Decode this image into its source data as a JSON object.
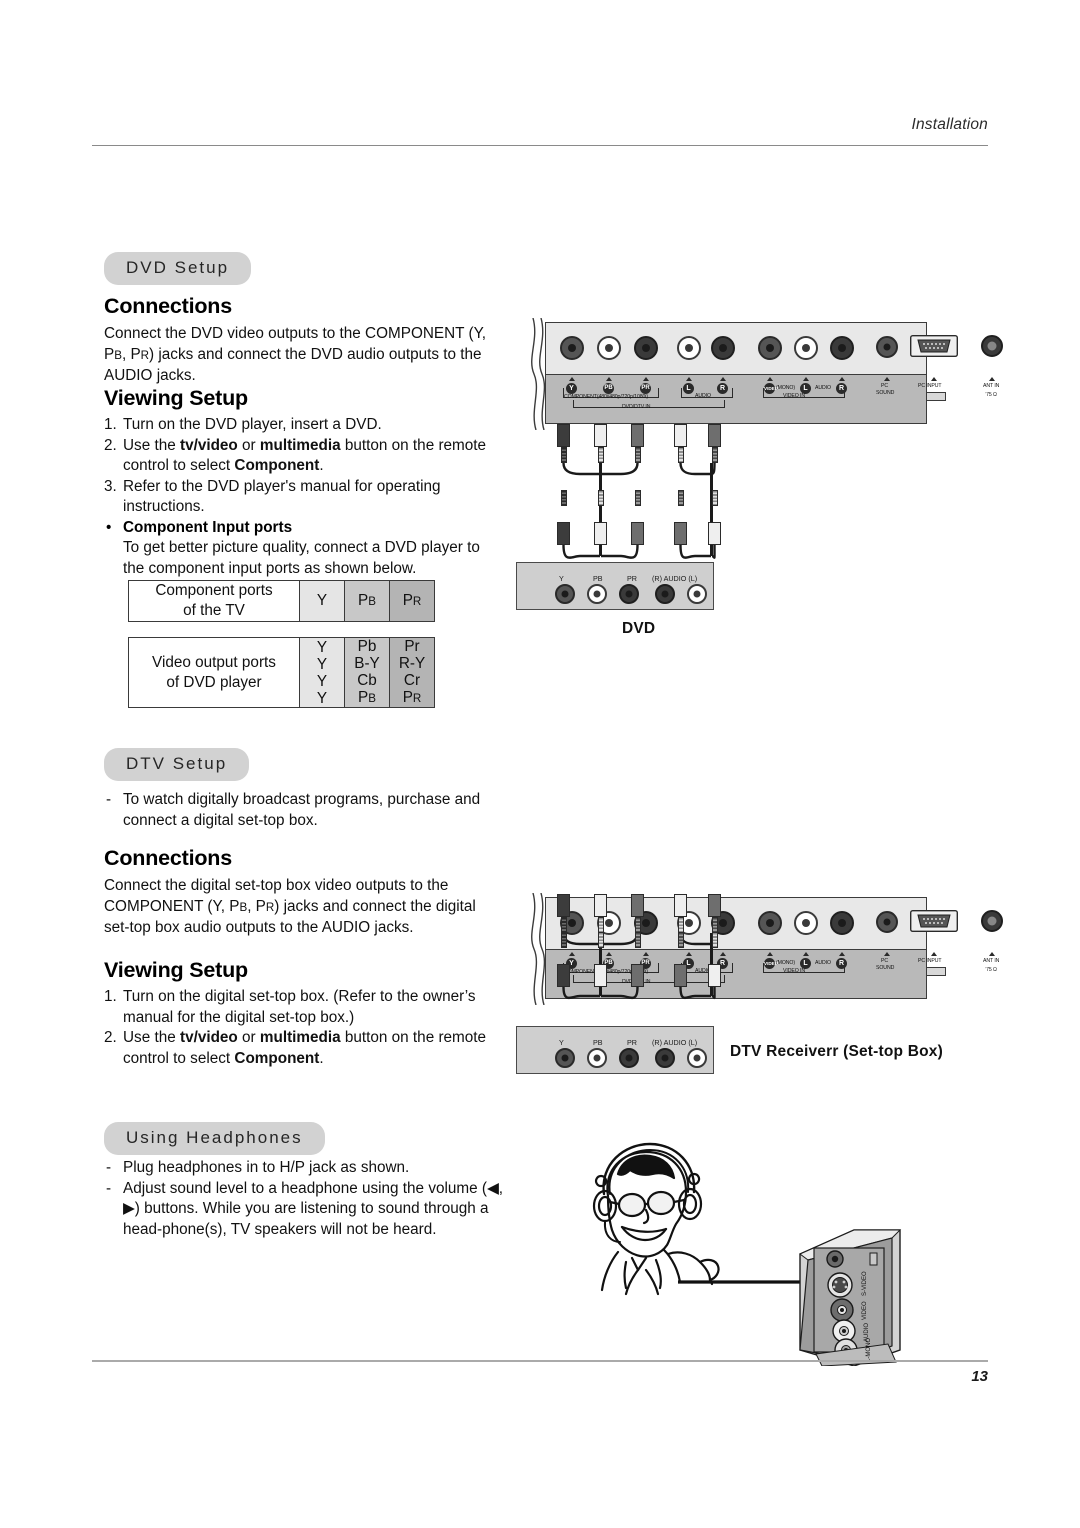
{
  "header": {
    "title": "Installation"
  },
  "footer": {
    "page_number": "13"
  },
  "sections": {
    "dvd": {
      "pill_label": "DVD Setup",
      "connections_heading": "Connections",
      "connections_body_line1": "Connect the DVD video outputs to the COMPONENT",
      "connections_body_line2_pre": "(Y, P",
      "connections_body_line2_sub1": "B",
      "connections_body_line2_mid": ", P",
      "connections_body_line2_sub2": "R",
      "connections_body_line2_post": ") jacks and connect the DVD audio outputs",
      "connections_body_line3": "to the AUDIO jacks.",
      "viewing_heading": "Viewing Setup",
      "steps": [
        {
          "num": "1.",
          "text": "Turn on the DVD player, insert a DVD."
        },
        {
          "num": "2.",
          "text_a": "Use the ",
          "bold_a": "tv/video",
          "text_b": " or ",
          "bold_b": "multimedia",
          "text_c": " button on the remote control to select ",
          "bold_c": "Component",
          "text_d": "."
        },
        {
          "num": "3.",
          "text": "Refer to the DVD player's manual for operating instructions."
        }
      ],
      "component_bullet": "•",
      "component_heading": "Component Input ports",
      "component_body": "To get better picture quality, connect a DVD player to the component input ports as shown below.",
      "table1": {
        "row_label_line1": "Component ports",
        "row_label_line2": "of the TV",
        "cols": [
          "Y",
          "PB",
          "PR"
        ],
        "col_plain": [
          "Y",
          "P",
          "P"
        ],
        "col_subs": [
          "",
          "B",
          "R"
        ]
      },
      "table2": {
        "row_label_line1": "Video output ports",
        "row_label_line2": "of DVD player",
        "col1": [
          "Y",
          "Y",
          "Y",
          "Y"
        ],
        "col2": [
          "Pb",
          "B-Y",
          "Cb",
          "PB"
        ],
        "col3": [
          "Pr",
          "R-Y",
          "Cr",
          "PR"
        ],
        "col2_last_plain": "P",
        "col2_last_sub": "B",
        "col3_last_plain": "P",
        "col3_last_sub": "R"
      },
      "device_caption": "DVD"
    },
    "dtv": {
      "pill_label": "DTV Setup",
      "intro_bullet": "-",
      "intro_text": "To watch digitally broadcast programs, purchase and connect a digital set-top box.",
      "connections_heading": "Connections",
      "connections_body_line1": "Connect the digital set-top box video outputs to the",
      "connections_body_line2_pre": "COMPONENT (Y, P",
      "connections_body_line2_sub1": "B",
      "connections_body_line2_mid": ", P",
      "connections_body_line2_sub2": "R",
      "connections_body_line2_post": ") jacks and connect the",
      "connections_body_line3": "digital set-top box audio outputs to the AUDIO",
      "connections_body_line4": "jacks.",
      "viewing_heading": "Viewing Setup",
      "steps": [
        {
          "num": "1.",
          "text": "Turn on the digital set-top box. (Refer to the owner’s manual for the digital set-top box.)"
        },
        {
          "num": "2.",
          "text_a": "Use the ",
          "bold_a": "tv/video",
          "text_b": " or ",
          "bold_b": "multimedia",
          "text_c": " button on the remote control to select ",
          "bold_c": "Component",
          "text_d": "."
        }
      ],
      "device_caption": "DTV Receiverr (Set-top Box)"
    },
    "headphones": {
      "pill_label": "Using Headphones",
      "items": [
        {
          "bullet": "-",
          "text": "Plug headphones in to H/P jack as shown."
        },
        {
          "bullet": "-",
          "text_a": "Adjust sound level to a headphone using the volume (",
          "glyph_left": "◀",
          "text_b": ", ",
          "glyph_right": "▶",
          "text_c": ") buttons. While you are listening to sound through a head-phone(s), TV speakers will not be heard."
        }
      ]
    }
  },
  "tv_panel": {
    "labels": {
      "y": "Y",
      "pb": "PB",
      "pr": "PR",
      "l": "L",
      "r": "R",
      "video_y": "VIDEO",
      "mono": "(MONO)",
      "audio_l": "L",
      "audio_mid": "AUDIO",
      "audio_r": "R",
      "component": "COMPONENT(480i/480p/720p/1080i)",
      "audio_bracket": "AUDIO",
      "dvd_dtv_in": "DVD/DTV IN",
      "video_in": "VIDEO IN",
      "pc_sound_line1": "PC",
      "pc_sound_line2": "SOUND",
      "pc_input": "PC INPUT",
      "ant_in_line1": "ANT IN",
      "ant_in_line2": "‵75 Ω"
    }
  },
  "device_panel": {
    "labels": {
      "y": "Y",
      "pb": "PB",
      "pr": "PR",
      "audio": "(R) AUDIO (L)"
    }
  },
  "side_panel": {
    "labels": [
      "S-VIDEO",
      "VIDEO",
      "AUDIO",
      "L-MONO"
    ]
  },
  "colors": {
    "pill_bg": "#d2d2d2",
    "panel_top": "#e8e8e8",
    "panel_bottom": "#b9b9b9",
    "device_bg": "#cfcfcf",
    "table_shade_1": "#e5e5e5",
    "table_shade_2": "#c8c8c8",
    "table_shade_3": "#b4b4b4",
    "text": "#111111"
  }
}
